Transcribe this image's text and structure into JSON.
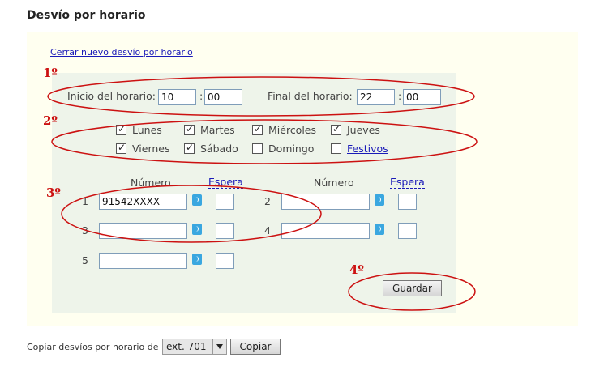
{
  "page": {
    "title": "Desvío por horario"
  },
  "close_link": "Cerrar nuevo desvío por horario",
  "annotations": {
    "step1": "1º",
    "step2": "2º",
    "step3": "3º",
    "step4": "4º"
  },
  "schedule": {
    "start_label": "Inicio del horario:",
    "start_hour": "10",
    "start_minute": "00",
    "end_label": "Final del horario:",
    "end_hour": "22",
    "end_minute": "00",
    "separator": ":"
  },
  "days": [
    {
      "label": "Lunes",
      "checked": true
    },
    {
      "label": "Martes",
      "checked": true
    },
    {
      "label": "Miércoles",
      "checked": true
    },
    {
      "label": "Jueves",
      "checked": true
    },
    {
      "label": "Viernes",
      "checked": true
    },
    {
      "label": "Sábado",
      "checked": true
    },
    {
      "label": "Domingo",
      "checked": false
    },
    {
      "label": "Festivos",
      "checked": false
    }
  ],
  "numbers": {
    "col_numero": "Número",
    "col_espera": "Espera",
    "rows": [
      {
        "index": "1",
        "value": "91542XXXX",
        "wait": ""
      },
      {
        "index": "2",
        "value": "",
        "wait": ""
      },
      {
        "index": "3",
        "value": "",
        "wait": ""
      },
      {
        "index": "4",
        "value": "",
        "wait": ""
      },
      {
        "index": "5",
        "value": "",
        "wait": ""
      }
    ]
  },
  "save_button": "Guardar",
  "copy": {
    "label": "Copiar desvíos por horario de",
    "selected": "ext. 701",
    "button": "Copiar"
  },
  "colors": {
    "annotation": "#cc1111",
    "link": "#1a1ab8",
    "green_panel": "#eef4ea",
    "yellow_panel": "#fffff0"
  }
}
